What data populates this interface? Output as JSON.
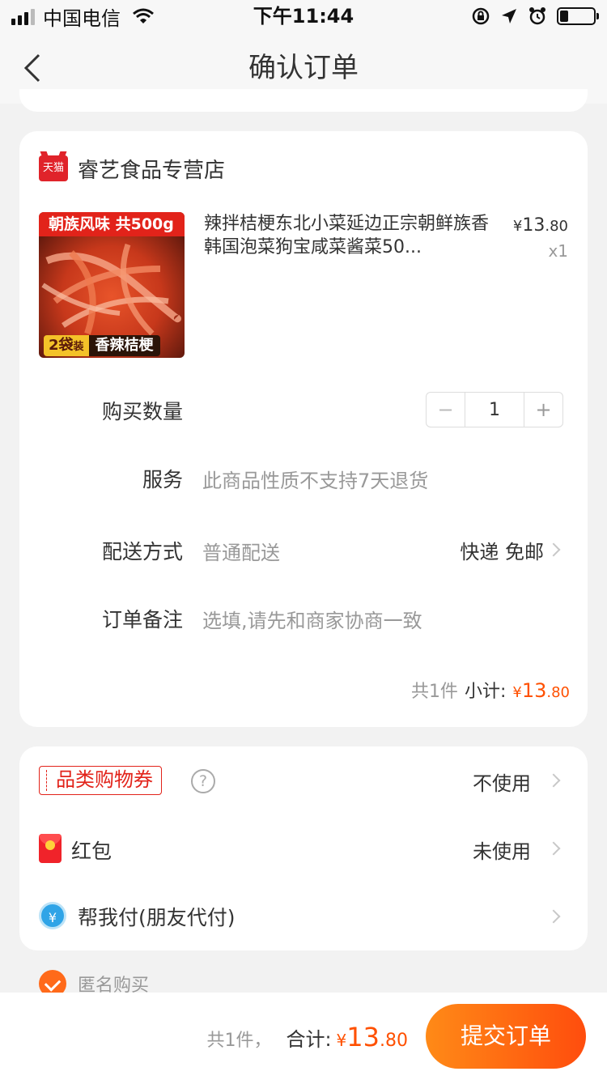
{
  "status_bar": {
    "carrier": "中国电信",
    "time": "下午11:44",
    "battery_level": 0.25
  },
  "nav": {
    "title": "确认订单"
  },
  "shop": {
    "badge": "天猫",
    "name": "睿艺食品专营店"
  },
  "product": {
    "image_banner": "朝族风味  共500g",
    "image_tag_count": "2袋",
    "image_tag_unit": "装",
    "image_tag_name": "香辣桔梗",
    "title": "辣拌桔梗东北小菜延边正宗朝鲜族香韩国泡菜狗宝咸菜酱菜50...",
    "price_yen": "¥",
    "price_int": "13",
    "price_dec": ".80",
    "qty": "x1"
  },
  "quantity": {
    "label": "购买数量",
    "minus": "−",
    "value": "1",
    "plus": "+"
  },
  "service": {
    "label": "服务",
    "value": "此商品性质不支持7天退货"
  },
  "delivery": {
    "label": "配送方式",
    "value": "普通配送",
    "right": "快递 免邮"
  },
  "remark": {
    "label": "订单备注",
    "placeholder": "选填,请先和商家协商一致"
  },
  "subtotal": {
    "count": "共1件",
    "label": "小计:",
    "yen": "¥",
    "int": "13",
    "dec": ".80"
  },
  "options": {
    "coupon": {
      "label": "品类购物券",
      "help": "?",
      "value": "不使用"
    },
    "redpacket": {
      "label": "红包",
      "value": "未使用"
    },
    "friendpay": {
      "icon_text": "¥",
      "label": "帮我付(朋友代付)"
    }
  },
  "anonymous": {
    "label": "匿名购买"
  },
  "footer": {
    "count": "共1件，",
    "label": "合计:",
    "yen": "¥",
    "int": "13",
    "dec": ".80",
    "submit": "提交订单"
  },
  "colors": {
    "accent": "#ff5000",
    "tmall_red": "#e2231a",
    "submit_start": "#ff8a17",
    "submit_end": "#ff4d0d",
    "background": "#f2f2f2"
  }
}
